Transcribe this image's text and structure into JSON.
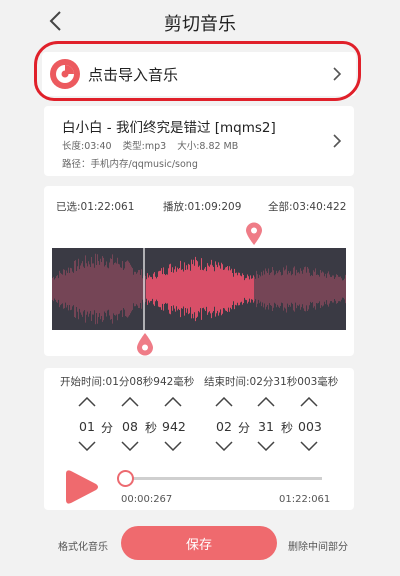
{
  "header": {
    "title": "剪切音乐",
    "back_icon": "chevron-left-icon"
  },
  "import": {
    "label": "点击导入音乐",
    "icon": "music-disc-icon",
    "accent": "#ec5a5f"
  },
  "song": {
    "title": "白小白 - 我们终究是错过 [mqms2]",
    "length": "长度:03:40",
    "type": "类型:mp3",
    "size": "大小:8.82 MB",
    "path": "路径：手机内存/qqmusic/song"
  },
  "times": {
    "selected": "已选:01:22:061",
    "playing": "播放:01:09:209",
    "total": "全部:03:40:422"
  },
  "range": {
    "start_label": "开始时间:01分08秒942毫秒",
    "end_label": "结束时间:02分31秒003毫秒",
    "start": {
      "minutes": "01",
      "min_unit": "分",
      "seconds": "08",
      "sec_unit": "秒",
      "millis": "942"
    },
    "end": {
      "minutes": "02",
      "min_unit": "分",
      "seconds": "31",
      "sec_unit": "秒",
      "millis": "003"
    }
  },
  "player": {
    "current": "00:00:267",
    "duration": "01:22:061",
    "progress": 0.0
  },
  "actions": {
    "format": "格式化音乐",
    "save": "保存",
    "delete_middle": "删除中间部分"
  },
  "colors": {
    "accent": "#ef6a6e",
    "wave_selected": "#e0506a",
    "wave_dim": "#8a4a5c",
    "wave_bg": "#3a3a44",
    "annotation_outline": "#e0202a"
  }
}
